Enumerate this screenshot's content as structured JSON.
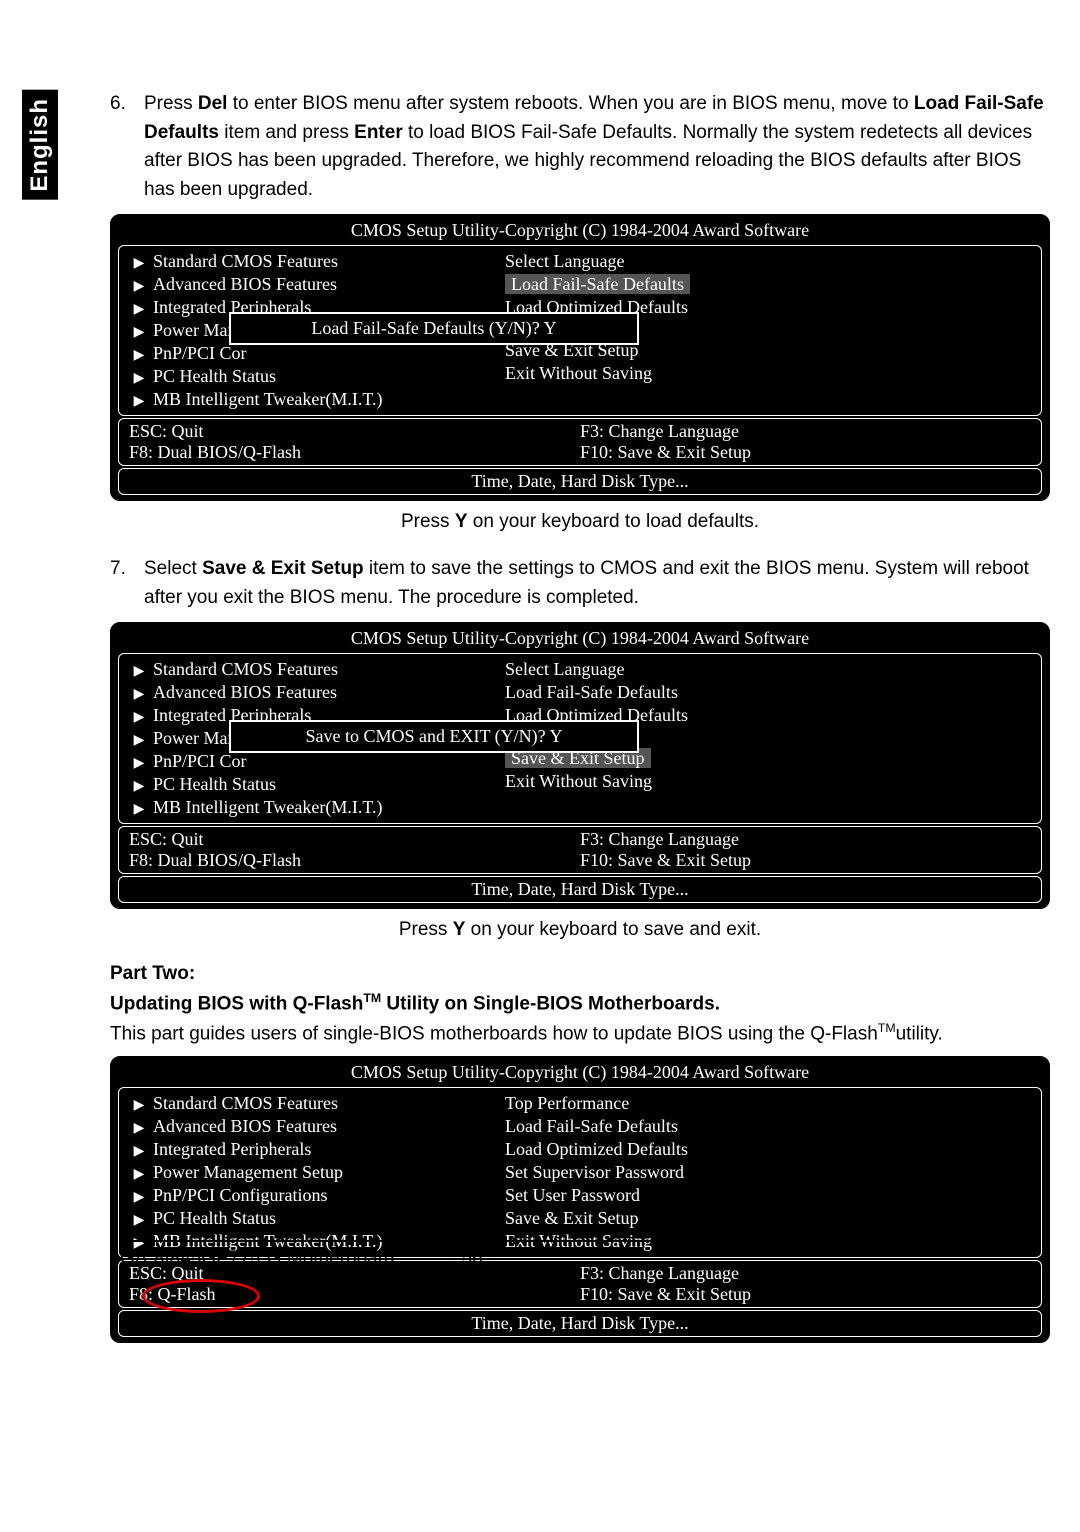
{
  "language_tab": "English",
  "step6_num": "6.",
  "step6_text_pre": "Press ",
  "step6_del": "Del",
  "step6_text_mid1": " to enter BIOS menu after system reboots. When you are in BIOS menu, move to ",
  "step6_bold1": "Load Fail-Safe Defaults",
  "step6_text_mid2": " item and press ",
  "step6_bold2": "Enter",
  "step6_text_end": " to load BIOS Fail-Safe Defaults. Normally the system redetects all devices after BIOS has been upgraded. Therefore, we highly recommend reloading the BIOS defaults after BIOS has been upgraded.",
  "bios_title": "CMOS Setup Utility-Copyright (C) 1984-2004 Award Software",
  "left_items": [
    "Standard CMOS Features",
    "Advanced BIOS Features",
    "Integrated Peripherals",
    "Power Mana",
    "PnP/PCI Cor",
    "PC Health Status",
    "MB Intelligent Tweaker(M.I.T.)"
  ],
  "left_items_full": [
    "Standard CMOS Features",
    "Advanced BIOS Features",
    "Integrated Peripherals",
    "Power Management Setup",
    "PnP/PCI Configurations",
    "PC Health Status",
    "MB Intelligent Tweaker(M.I.T.)"
  ],
  "right_items_a": [
    "Select Language",
    "Load Fail-Safe Defaults",
    "Load Optimized Defaults",
    "Save & Exit Setup",
    "Exit Without Saving"
  ],
  "right_items_b": [
    "Select Language",
    "Load Fail-Safe Defaults",
    "Load Optimized Defaults",
    "Save & Exit Setup",
    "Exit Without Saving"
  ],
  "right_items_c": [
    "Top Performance",
    "Load Fail-Safe Defaults",
    "Load Optimized Defaults",
    "Set Supervisor Password",
    "Set User Password",
    "Save & Exit Setup",
    "Exit Without Saving"
  ],
  "dialog_a": "Load Fail-Safe Defaults (Y/N)? Y",
  "dialog_b": "Save to CMOS and EXIT (Y/N)? Y",
  "help_l1": "ESC: Quit",
  "help_l2": "F8: Dual BIOS/Q-Flash",
  "help_l2_c": "F8: Q-Flash",
  "help_r1": "F3: Change Language",
  "help_r2": "F10: Save & Exit Setup",
  "status_line": "Time, Date, Hard Disk Type...",
  "caption1_pre": "Press ",
  "caption1_bold": "Y",
  "caption1_post": " on your keyboard to load defaults.",
  "step7_num": "7.",
  "step7_text_pre": "Select ",
  "step7_bold": "Save & Exit Setup",
  "step7_text_post": " item to save the settings to CMOS and exit the BIOS menu. System will reboot after you exit the BIOS menu. The procedure is completed.",
  "caption2_pre": "Press ",
  "caption2_bold": "Y",
  "caption2_post": " on your keyboard to save and exit.",
  "part_two": "Part Two:",
  "part_two_sub_pre": "Updating BIOS with Q-Flash",
  "part_two_sub_tm": "TM",
  "part_two_sub_post": " Utility on Single-BIOS Motherboards.",
  "part_two_body_pre": "This part guides users of single-BIOS motherboards how to update BIOS using the Q-Flash",
  "part_two_body_tm": "TM",
  "part_two_body_post": "utility.",
  "footer_model": "GA-8I845GE775-G Motherboard",
  "footer_page": "- 56 -"
}
